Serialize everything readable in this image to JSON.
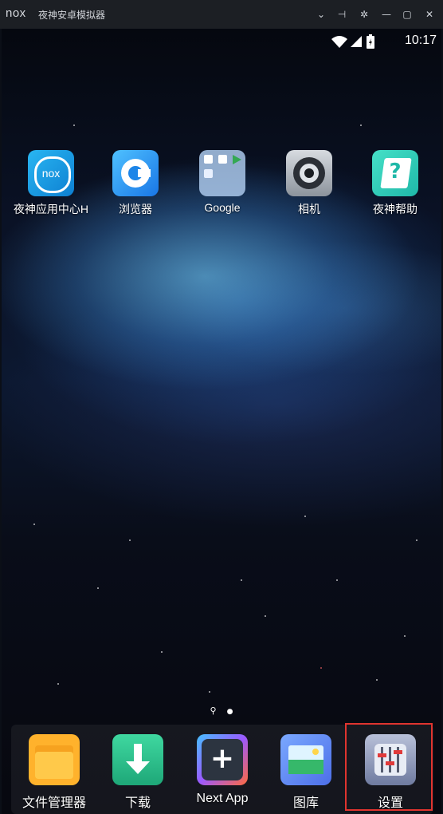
{
  "window": {
    "logo": "nox",
    "title": "夜神安卓模拟器",
    "controls": [
      {
        "name": "dropdown-icon",
        "glyph": "⌄"
      },
      {
        "name": "pin-icon",
        "glyph": "⊣"
      },
      {
        "name": "settings-icon",
        "glyph": "✲"
      },
      {
        "name": "minimize-icon",
        "glyph": "—"
      },
      {
        "name": "maximize-icon",
        "glyph": "▢"
      },
      {
        "name": "close-icon",
        "glyph": "✕"
      }
    ]
  },
  "status": {
    "time": "10:17"
  },
  "home_apps": [
    {
      "label": "夜神应用中心H",
      "icon": "nox-app-center-icon"
    },
    {
      "label": "浏览器",
      "icon": "browser-icon"
    },
    {
      "label": "Google",
      "icon": "google-folder-icon"
    },
    {
      "label": "相机",
      "icon": "camera-icon"
    },
    {
      "label": "夜神帮助",
      "icon": "nox-help-icon"
    }
  ],
  "pager": {
    "search_glyph": "⚲",
    "dot_glyph": "●"
  },
  "dock_apps": [
    {
      "label": "文件管理器",
      "icon": "file-manager-icon"
    },
    {
      "label": "下载",
      "icon": "download-icon"
    },
    {
      "label": "Next App",
      "icon": "next-app-icon"
    },
    {
      "label": "图库",
      "icon": "gallery-icon"
    },
    {
      "label": "设置",
      "icon": "settings-app-icon"
    }
  ],
  "colors": {
    "titlebar": "#1c1f24",
    "highlight": "#e0342f"
  }
}
